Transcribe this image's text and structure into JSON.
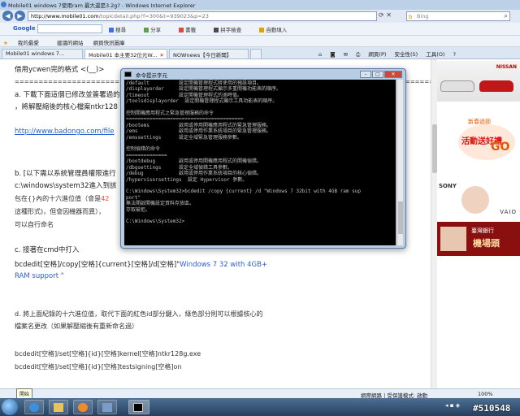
{
  "window": {
    "title": "Mobile01 windows 7使用ram 最大還是3.2g? - Windows Internet Explorer"
  },
  "address": {
    "host": "http://www.mobile01.com",
    "path": "/topicdetail.php?f=300&t=939023&p=23",
    "search_placeholder": "Bing"
  },
  "googlebar": {
    "logo": "Google",
    "items": [
      "搜尋",
      "分享",
      "",
      "書籤",
      "",
      "拼字檢查",
      "",
      "自動填入"
    ]
  },
  "favorites": {
    "label": "我的最愛",
    "items": [
      "建議的網站",
      "網頁快訊圖庫"
    ]
  },
  "tabs": [
    {
      "label": "Mobile01 windows 7...",
      "active": false
    },
    {
      "label": "Mobile01 本主要32位元W...",
      "active": true
    },
    {
      "label": "NOWnews【今日新聞】",
      "active": false
    }
  ],
  "tab_tools": [
    "網頁(P)",
    "安全性(S)",
    "工具(O)"
  ],
  "content": {
    "line1": "借用ycwen完的格式 <(__)>",
    "divider": "========================================================================================================",
    "a_line1": "a. 下載下面這個已修改並簽署過的",
    "a_line2": "，將解壓縮後的核心檔案ntkr128",
    "link": "http://www.badongo.com/file",
    "b_line1": "b. [以下需以系統管理員權限進行",
    "b_line2": "c:\\windows\\system32進入到該",
    "b_line3_pre": "包在{}內的十六進位值（會是",
    "b_line3_red": "42",
    "b_line4": "這種形式)，但會因機器而異），",
    "b_line5": "可以自行命名",
    "c_line1": "c. 接著在cmd中打入",
    "c_cmd_pre": "bcdedit[空格]/copy[空格]{current}[空格]/d[空格]\"",
    "c_cmd_blue": "Windows 7 32 with 4GB+",
    "c_cmd_blue2": "RAM support \"",
    "d_line1": "d. 將上面紀錄的十六進位值，取代下面的紅色id部分鍵入，綠色部分則可以根據核心的",
    "d_line2": "檔案名更改（如果解壓縮後有重新命名過）",
    "cmd1": "bcdedit[空格]/set[空格]{id}[空格]kernel[空格]ntkr128g.exe",
    "cmd2": "bcdedit[空格]/set[空格]{id}[空格]testsigning[空格]on"
  },
  "ads": {
    "car_brand": "NISSAN",
    "tagline_head": "新春過節",
    "tagline": "活動送好禮",
    "go": "GO",
    "sony": "SONY",
    "vaio": "VAIO",
    "bank": "臺灣銀行",
    "airport": "機場頭"
  },
  "cmd": {
    "title": "命令提示字元",
    "lines": [
      "/default          設定開機管理程式將使用的預設項目。",
      "/displayorder     設定開機管理程式顯示多重開機功能表的順序。",
      "/timeout          設定開機管理程式的逾時值。",
      "/toolsdisplayorder  設定開機管理程式顯示工具功能表的順序。",
      "",
      "控制開機應用程式之緊急管理服務的命令",
      "========================================",
      "/bootems          啟用或停用開機應用程式的緊急管理服務。",
      "/ems              啟用或停用作業系統項目的緊急管理服務。",
      "/emssettings      設定全域緊急管理服務參數。",
      "",
      "控制偵錯的命令",
      "==============",
      "/bootdebug        啟用或停用開機應用程式的開機偵錯。",
      "/dbgsettings      設定全域偵錯工具參數。",
      "/debug            啟用或停用作業系統項目的核心偵錯。",
      "/hypervisorsettings  設定 Hypervisor 參數。",
      "",
      "C:\\Windows\\System32>bcdedit /copy {current} /d \"Windows 7 32bit with 4GB ram sup",
      "port\"",
      "無法開啟開機設定資料存放區。",
      "存取被拒。",
      "",
      "C:\\Windows\\System32>"
    ]
  },
  "status": {
    "zone": "網際網路 | 受保護模式: 啟動",
    "zoom": "100%"
  },
  "taskbar": {
    "tooltip": "開始"
  },
  "watermark": "#510548"
}
